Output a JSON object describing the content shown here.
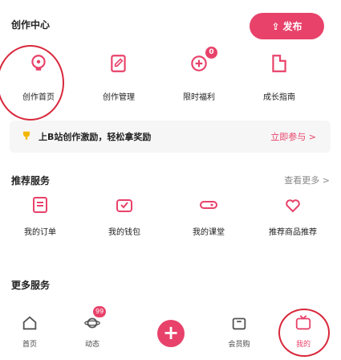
{
  "header": {
    "title": "创作中心",
    "publish_label": "发布",
    "publish_icon": "upload-icon"
  },
  "creator": {
    "items": [
      {
        "label": "创作首页",
        "icon": "bulb-icon"
      },
      {
        "label": "创作管理",
        "icon": "document-edit-icon"
      },
      {
        "label": "限时福利",
        "icon": "gift-icon",
        "badge": ""
      },
      {
        "label": "成长指南",
        "icon": "guide-icon"
      }
    ]
  },
  "promo": {
    "text": "上B站创作激励，轻松拿奖励",
    "link": "立即参与 >",
    "icon": "trophy-icon"
  },
  "recommend": {
    "title": "推荐服务",
    "more": "查看更多 >"
  },
  "services": [
    {
      "label": "我的订单",
      "icon": "order-icon"
    },
    {
      "label": "我的钱包",
      "icon": "wallet-icon"
    },
    {
      "label": "我的课堂",
      "icon": "game-controller-icon"
    },
    {
      "label": "推荐商品推荐",
      "icon": "heart-shop-icon"
    }
  ],
  "more_services": {
    "title": "更多服务"
  },
  "nav": {
    "items": [
      {
        "label": "首页",
        "icon": "home-icon"
      },
      {
        "label": "动态",
        "icon": "planet-icon",
        "badge": "99"
      },
      {
        "label": "会员购",
        "icon": "bag-icon"
      },
      {
        "label": "我的",
        "icon": "tv-icon"
      }
    ]
  },
  "colors": {
    "accent": "#e8426a",
    "highlight_circle": "#d8283b"
  }
}
